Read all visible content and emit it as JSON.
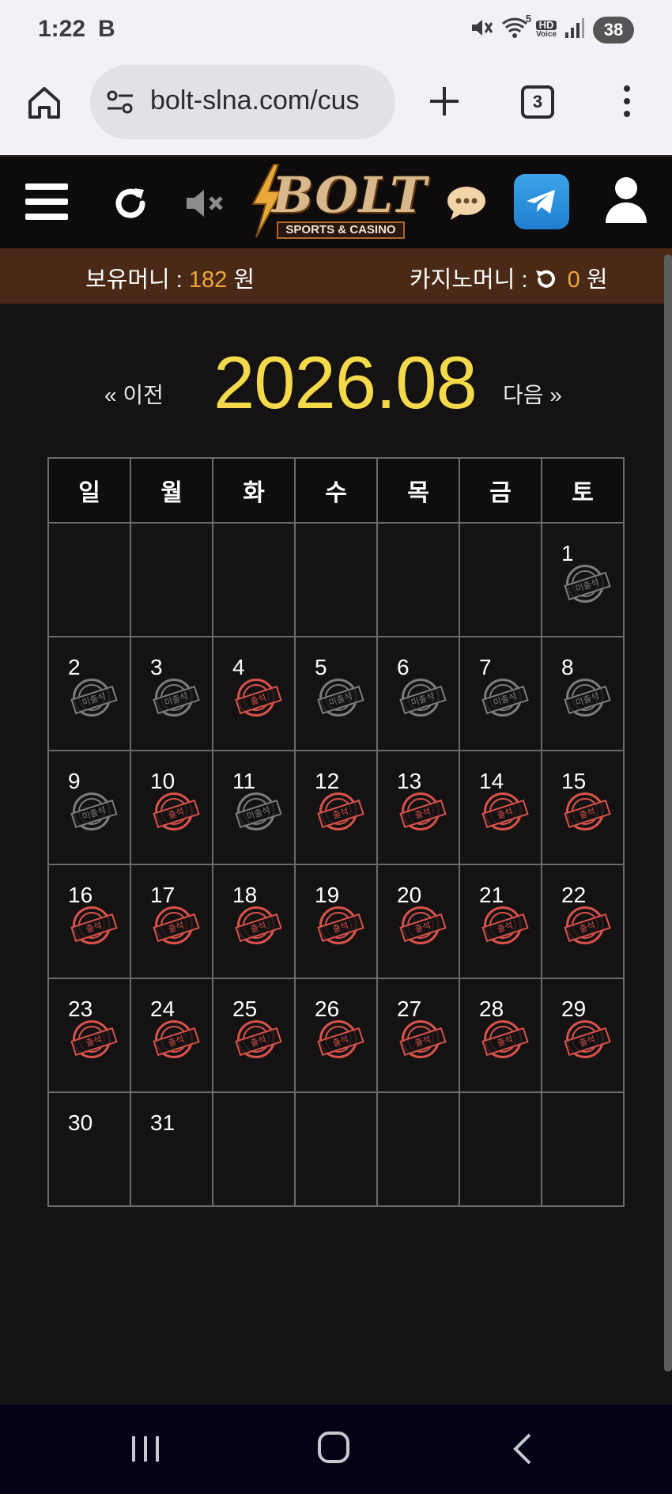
{
  "status_bar": {
    "time": "1:22",
    "b_icon": "B",
    "hd_label": "HD",
    "voice_label": "Voice",
    "wifi_badge": "5",
    "battery": "38"
  },
  "browser": {
    "url": "bolt-slna.com/cus",
    "tab_count": "3"
  },
  "site_header": {
    "logo_text": "BOLT",
    "logo_sub": "SPORTS & CASINO",
    "accent_color": "#d9b88b"
  },
  "money": {
    "hold_label": "보유머니 :",
    "hold_amount": "182",
    "hold_unit": "원",
    "casino_label": "카지노머니 :",
    "casino_amount": "0",
    "casino_unit": "원",
    "amount_color": "#f0a63a"
  },
  "calendar": {
    "prev_label": "« 이전",
    "next_label": "다음 »",
    "month": "2026.08",
    "weekdays": [
      "일",
      "월",
      "화",
      "수",
      "목",
      "금",
      "토"
    ],
    "present_label": "출석",
    "absent_label": "미출석",
    "weeks": [
      [
        null,
        null,
        null,
        null,
        null,
        null,
        {
          "day": "1",
          "status": "absent"
        }
      ],
      [
        {
          "day": "2",
          "status": "absent"
        },
        {
          "day": "3",
          "status": "absent"
        },
        {
          "day": "4",
          "status": "present"
        },
        {
          "day": "5",
          "status": "absent"
        },
        {
          "day": "6",
          "status": "absent"
        },
        {
          "day": "7",
          "status": "absent"
        },
        {
          "day": "8",
          "status": "absent"
        }
      ],
      [
        {
          "day": "9",
          "status": "absent"
        },
        {
          "day": "10",
          "status": "present"
        },
        {
          "day": "11",
          "status": "absent"
        },
        {
          "day": "12",
          "status": "present"
        },
        {
          "day": "13",
          "status": "present"
        },
        {
          "day": "14",
          "status": "present"
        },
        {
          "day": "15",
          "status": "present"
        }
      ],
      [
        {
          "day": "16",
          "status": "present"
        },
        {
          "day": "17",
          "status": "present"
        },
        {
          "day": "18",
          "status": "present"
        },
        {
          "day": "19",
          "status": "present"
        },
        {
          "day": "20",
          "status": "present"
        },
        {
          "day": "21",
          "status": "present"
        },
        {
          "day": "22",
          "status": "present"
        }
      ],
      [
        {
          "day": "23",
          "status": "present"
        },
        {
          "day": "24",
          "status": "present"
        },
        {
          "day": "25",
          "status": "present"
        },
        {
          "day": "26",
          "status": "present"
        },
        {
          "day": "27",
          "status": "present"
        },
        {
          "day": "28",
          "status": "present"
        },
        {
          "day": "29",
          "status": "present"
        }
      ],
      [
        {
          "day": "30",
          "status": "none"
        },
        {
          "day": "31",
          "status": "none"
        },
        null,
        null,
        null,
        null,
        null
      ]
    ],
    "month_color": "#f4d94a",
    "present_color": "#d9534b",
    "absent_color": "#7d7d7d"
  },
  "icons": [
    "home-icon",
    "site-settings-icon",
    "plus-icon",
    "tabs-icon",
    "more-icon",
    "hamburger-icon",
    "refresh-icon",
    "mute-icon",
    "chat-icon",
    "telegram-icon",
    "user-icon",
    "recents-icon",
    "nav-home-icon",
    "back-icon"
  ]
}
